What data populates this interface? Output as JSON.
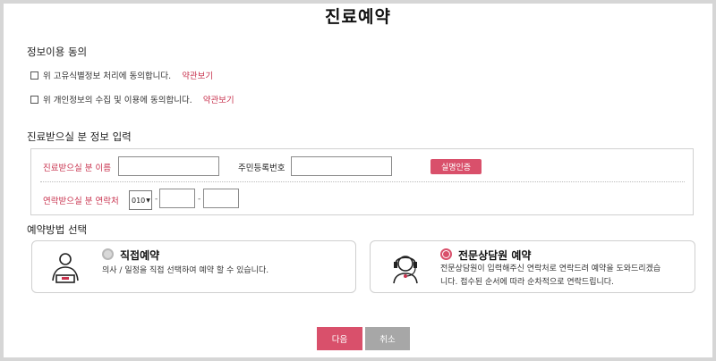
{
  "page": {
    "title": "진료예약"
  },
  "consent": {
    "heading": "정보이용 동의",
    "items": [
      {
        "label": "위 고유식별정보 처리에 동의합니다.",
        "link": "약관보기"
      },
      {
        "label": "위 개인정보의 수집 및 이용에 동의합니다.",
        "link": "약관보기"
      }
    ]
  },
  "patient": {
    "heading": "진료받으실 분 정보 입력",
    "name_label": "진료받으실 분 이름",
    "id_label": "주민등록번호",
    "verify_button": "실명인증",
    "contact_label": "연락받으실 분 연락처",
    "phone_prefix": "010",
    "dash": "-"
  },
  "method": {
    "heading": "예약방법 선택",
    "direct": {
      "title": "직접예약",
      "desc": "의사 / 일정을 직접 선택하여 예약 할 수 있습니다."
    },
    "counselor": {
      "title": "전문상담원 예약",
      "desc_line1": "전문상담원이 입력해주신 연락처로 연락드려 예약을 도와드리겠습",
      "desc_line2": "니다. 접수된 순서에 따라 순차적으로 연락드립니다."
    }
  },
  "actions": {
    "next": "다음",
    "cancel": "취소"
  },
  "colors": {
    "accent": "#c8324e",
    "button_primary": "#d9506b",
    "button_secondary": "#a7a7a7"
  }
}
